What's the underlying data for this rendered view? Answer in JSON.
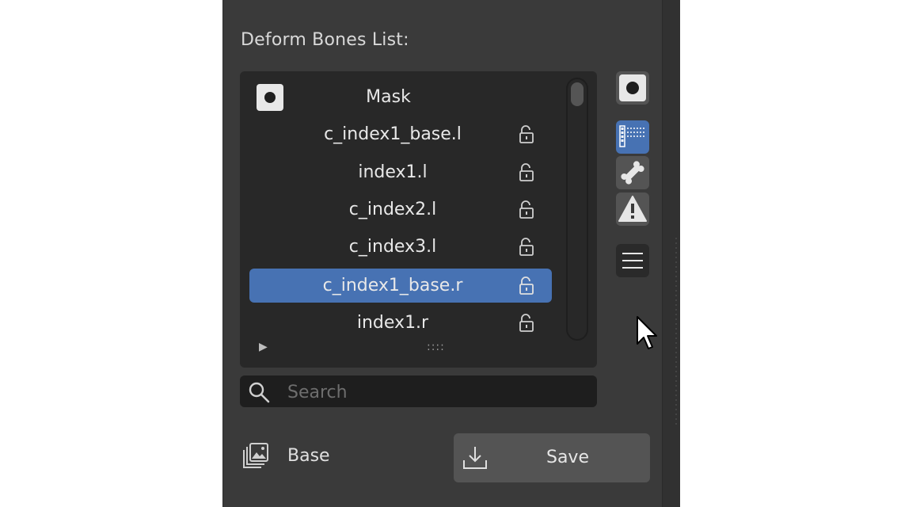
{
  "panel": {
    "title": "Deform Bones List:"
  },
  "list": {
    "mask_label": "Mask",
    "items": [
      {
        "label": "c_index1_base.l",
        "selected": false
      },
      {
        "label": "index1.l",
        "selected": false
      },
      {
        "label": "c_index2.l",
        "selected": false
      },
      {
        "label": "c_index3.l",
        "selected": false
      },
      {
        "label": "c_index1_base.r",
        "selected": true
      },
      {
        "label": "index1.r",
        "selected": false
      }
    ],
    "expand_icon": "triangle-right-icon",
    "grip_text": "::::"
  },
  "search": {
    "placeholder": "Search",
    "value": ""
  },
  "side_toolbar": {
    "buttons": [
      "mask-toggle-icon",
      "list-icon",
      "bone-icon",
      "warning-icon",
      "menu-icon"
    ]
  },
  "footer": {
    "base_label": "Base",
    "save_label": "Save"
  },
  "colors": {
    "panel_bg": "#3a3a3a",
    "list_bg": "#282828",
    "selection": "#4772b3",
    "button": "#545454"
  }
}
